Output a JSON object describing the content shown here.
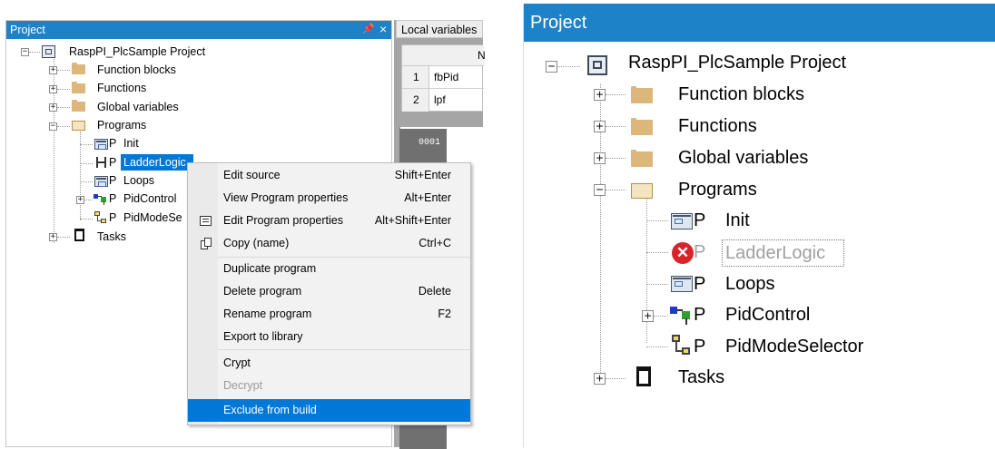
{
  "left_panel": {
    "title": "Project",
    "pin_icon": "pin-icon",
    "close_glyph": "×",
    "tree": {
      "root": "RaspPI_PlcSample Project",
      "items": [
        "Function blocks",
        "Functions",
        "Global variables",
        "Programs"
      ],
      "programs": [
        "Init",
        "LadderLogic",
        "Loops",
        "PidControl",
        "PidModeSelector"
      ],
      "programs_truncated": [
        "Init",
        "LadderLogic",
        "Loops",
        "PidControl",
        "PidModeSe"
      ],
      "tasks": "Tasks",
      "prefix_letter": "P"
    }
  },
  "local_vars": {
    "tab_title": "Local variables",
    "header_fragment": "N",
    "rows": [
      {
        "num": "1",
        "name": "fbPid"
      },
      {
        "num": "2",
        "name": "lpf"
      }
    ],
    "rung_number": "0001"
  },
  "context_menu": {
    "items": [
      {
        "label": "Edit source",
        "shortcut": "Shift+Enter"
      },
      {
        "label": "View Program properties",
        "shortcut": "Alt+Enter"
      },
      {
        "label": "Edit Program properties",
        "shortcut": "Alt+Shift+Enter"
      },
      {
        "label": "Copy (name)",
        "shortcut": "Ctrl+C"
      },
      {
        "label": "Duplicate program",
        "shortcut": ""
      },
      {
        "label": "Delete program",
        "shortcut": "Delete"
      },
      {
        "label": "Rename program",
        "shortcut": "F2"
      },
      {
        "label": "Export to library",
        "shortcut": ""
      },
      {
        "label": "Crypt",
        "shortcut": ""
      },
      {
        "label": "Decrypt",
        "shortcut": ""
      },
      {
        "label": "Exclude from build",
        "shortcut": ""
      }
    ]
  },
  "right_panel": {
    "title": "Project",
    "tree": {
      "root": "RaspPI_PlcSample Project",
      "items": [
        "Function blocks",
        "Functions",
        "Global variables",
        "Programs"
      ],
      "programs": [
        "Init",
        "LadderLogic",
        "Loops",
        "PidControl",
        "PidModeSelector"
      ],
      "tasks": "Tasks",
      "prefix_letter": "P"
    }
  },
  "colors": {
    "title_bar": "#1e82c8",
    "selection": "#0078d7",
    "menu_highlight": "#0078d7",
    "error_red": "#d8232a",
    "excluded_text": "#a0a0a0"
  }
}
